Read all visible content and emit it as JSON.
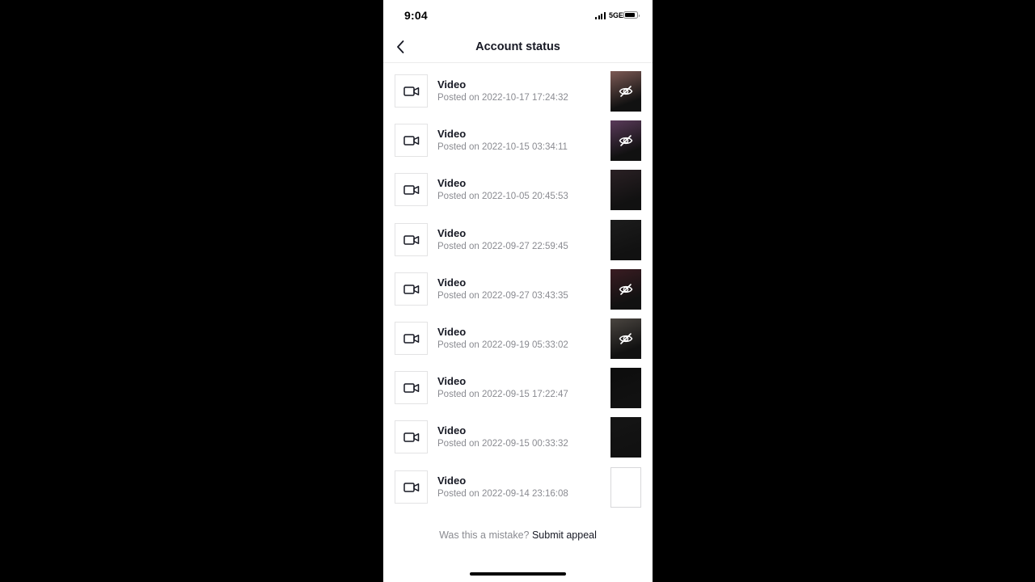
{
  "status_bar": {
    "time": "9:04",
    "network": "5GE"
  },
  "header": {
    "title": "Account status"
  },
  "videos": [
    {
      "title": "Video",
      "posted": "Posted on 2022-10-17 17:24:32",
      "thumb": "hidden"
    },
    {
      "title": "Video",
      "posted": "Posted on 2022-10-15 03:34:11",
      "thumb": "hidden"
    },
    {
      "title": "Video",
      "posted": "Posted on 2022-10-05 20:45:53",
      "thumb": "image"
    },
    {
      "title": "Video",
      "posted": "Posted on 2022-09-27 22:59:45",
      "thumb": "image"
    },
    {
      "title": "Video",
      "posted": "Posted on 2022-09-27 03:43:35",
      "thumb": "hidden"
    },
    {
      "title": "Video",
      "posted": "Posted on 2022-09-19 05:33:02",
      "thumb": "hidden"
    },
    {
      "title": "Video",
      "posted": "Posted on 2022-09-15 17:22:47",
      "thumb": "image"
    },
    {
      "title": "Video",
      "posted": "Posted on 2022-09-15 00:33:32",
      "thumb": "image"
    },
    {
      "title": "Video",
      "posted": "Posted on 2022-09-14 23:16:08",
      "thumb": "blank"
    }
  ],
  "icons": {
    "back": "chevron-left-icon",
    "row": "video-camera-icon",
    "hidden": "eye-slash-icon"
  },
  "thumb_colors": [
    "#7d5a55",
    "#5a3a5a",
    "#2a2024",
    "#1c1c1c",
    "#3a1c22",
    "#4a4540",
    "#0d0d0d",
    "#151515",
    "#ffffff"
  ],
  "appeal": {
    "prompt": "Was this a mistake?",
    "link": "Submit appeal"
  }
}
